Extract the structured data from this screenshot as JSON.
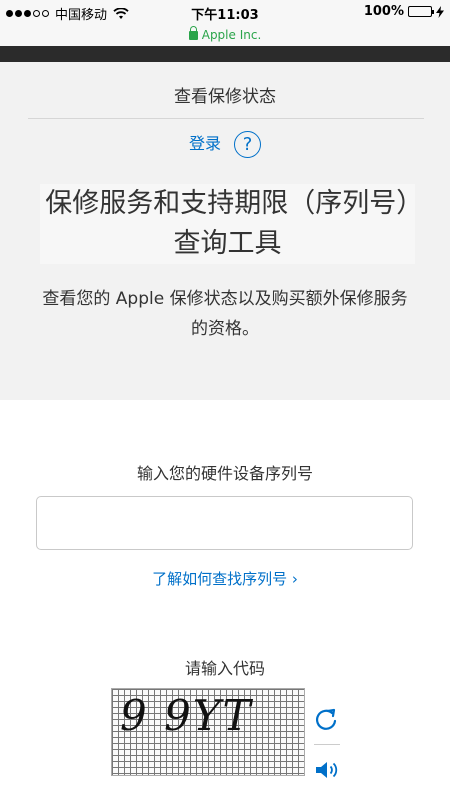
{
  "status": {
    "carrier": "中国移动",
    "time": "下午11:03",
    "battery": "100%",
    "battery_level": 1.0,
    "signal_bars_filled": 3,
    "signal_bars_total": 5
  },
  "address": {
    "site": "Apple Inc."
  },
  "header": {
    "breadcrumb": "查看保修状态",
    "login": "登录",
    "help_glyph": "?",
    "title": "保修服务和支持期限（序列号）查询工具",
    "description": "查看您的 Apple 保修状态以及购买额外保修服务的资格。"
  },
  "form": {
    "serial_label": "输入您的硬件设备序列号",
    "serial_value": "",
    "find_serial_link": "了解如何查找序列号 ›",
    "code_label": "请输入代码",
    "captcha_text": "9 9YT"
  },
  "icons": {
    "refresh": "refresh-icon",
    "sound": "speaker-icon",
    "help": "help-icon",
    "lock": "lock-icon",
    "wifi": "wifi-icon",
    "charging": "charging-icon"
  },
  "colors": {
    "link": "#0070c9",
    "secure": "#2aa44a",
    "gray_bg": "#f2f2f2"
  }
}
